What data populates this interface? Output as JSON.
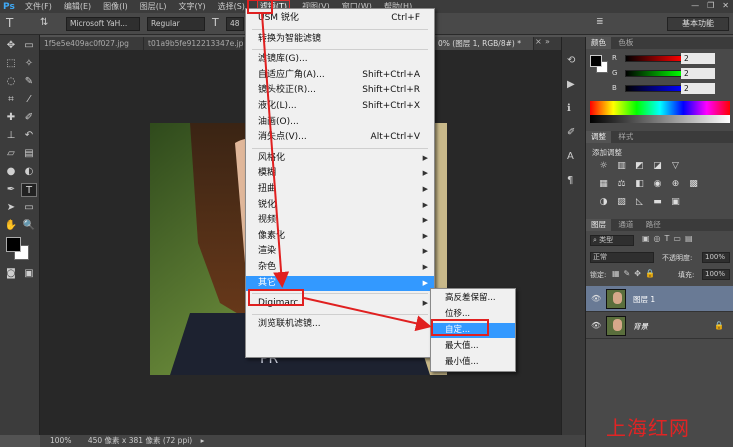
{
  "menubar": {
    "logo": "Ps",
    "items": [
      "文件(F)",
      "编辑(E)",
      "图像(I)",
      "图层(L)",
      "文字(Y)",
      "选择(S)",
      "滤镜(T)",
      "视图(V)",
      "窗口(W)",
      "帮助(H)"
    ],
    "active_index": 6
  },
  "options_bar": {
    "font_family": "Microsoft YaH...",
    "font_style": "Regular",
    "font_size": "48",
    "workspace": "基本功能"
  },
  "tabs": [
    {
      "label": "1f5e5e409ac0f027.jpg"
    },
    {
      "label": "t01a9b5fe912213347e.jpg"
    },
    {
      "label": "0% (图层 1, RGB/8#) *"
    }
  ],
  "filter_menu": {
    "items": [
      {
        "label": "USM 锐化",
        "shortcut": "Ctrl+F"
      },
      {
        "sep": true
      },
      {
        "label": "转换为智能滤镜"
      },
      {
        "sep": true
      },
      {
        "label": "滤镜库(G)..."
      },
      {
        "label": "自适应广角(A)...",
        "shortcut": "Shift+Ctrl+A"
      },
      {
        "label": "镜头校正(R)...",
        "shortcut": "Shift+Ctrl+R"
      },
      {
        "label": "液化(L)...",
        "shortcut": "Shift+Ctrl+X"
      },
      {
        "label": "油画(O)..."
      },
      {
        "label": "消失点(V)...",
        "shortcut": "Alt+Ctrl+V"
      },
      {
        "sep": true
      },
      {
        "label": "风格化",
        "submenu": true
      },
      {
        "label": "模糊",
        "submenu": true
      },
      {
        "label": "扭曲",
        "submenu": true
      },
      {
        "label": "锐化",
        "submenu": true
      },
      {
        "label": "视频",
        "submenu": true
      },
      {
        "label": "像素化",
        "submenu": true
      },
      {
        "label": "渲染",
        "submenu": true
      },
      {
        "label": "杂色",
        "submenu": true
      },
      {
        "label": "其它",
        "submenu": true,
        "highlighted": true
      },
      {
        "sep": true
      },
      {
        "label": "Digimarc",
        "submenu": true
      },
      {
        "sep": true
      },
      {
        "label": "浏览联机滤镜..."
      }
    ]
  },
  "other_submenu": {
    "items": [
      {
        "label": "高反差保留..."
      },
      {
        "label": "位移..."
      },
      {
        "label": "自定...",
        "highlighted": true
      },
      {
        "label": "最大值..."
      },
      {
        "label": "最小值..."
      }
    ]
  },
  "status_bar": {
    "zoom": "100%",
    "doc_info": "450 像素 x 381 像素 (72 ppi)"
  },
  "color_panel": {
    "tabs": [
      "颜色",
      "色板"
    ],
    "channels": [
      {
        "label": "R",
        "value": "2"
      },
      {
        "label": "G",
        "value": "2"
      },
      {
        "label": "B",
        "value": "2"
      }
    ]
  },
  "adjust_panel": {
    "tabs": [
      "调整",
      "样式"
    ],
    "title": "添加调整"
  },
  "layers_panel": {
    "tabs": [
      "图层",
      "通道",
      "路径"
    ],
    "kind_filter": "类型",
    "blend_mode": "正常",
    "opacity_label": "不透明度:",
    "opacity": "100%",
    "lock_label": "锁定:",
    "fill_label": "填充:",
    "fill": "100%",
    "layers": [
      {
        "name": "图层 1",
        "selected": true
      },
      {
        "name": "背景",
        "locked": true
      }
    ]
  },
  "watermark": "上海红网",
  "colors": {
    "menu_highlight": "#3399ff",
    "annotation_red": "#e02020",
    "ps_blue": "#3fa9f5"
  }
}
